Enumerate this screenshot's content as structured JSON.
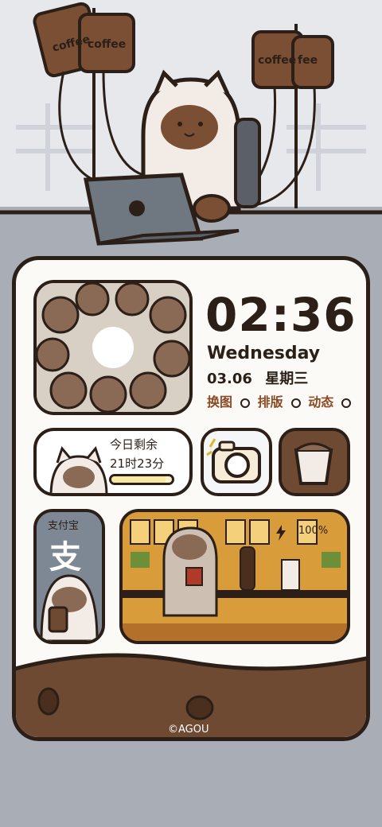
{
  "status": {
    "icons": [
      "mute-icon",
      "alarm-icon",
      "signal-icon",
      "wifi-icon",
      "battery-icon"
    ],
    "battery": "100"
  },
  "widgets": {
    "time": "02:36",
    "weekday": "Wednesday",
    "date": "03.06",
    "weekday_cn": "星期三",
    "links": [
      "换图",
      "排版",
      "动态"
    ],
    "rest_title": "今日剩余",
    "rest_value": "21时23分",
    "rest_progress": 0.9,
    "alipay": "支付宝",
    "alipay_char": "支",
    "battery_label": "100%",
    "credit": "©AGOU"
  },
  "colors": {
    "bg": "#a9aeb6",
    "outline": "#2b1f17",
    "brown": "#6e4a32",
    "cream": "#fbfaf7"
  }
}
